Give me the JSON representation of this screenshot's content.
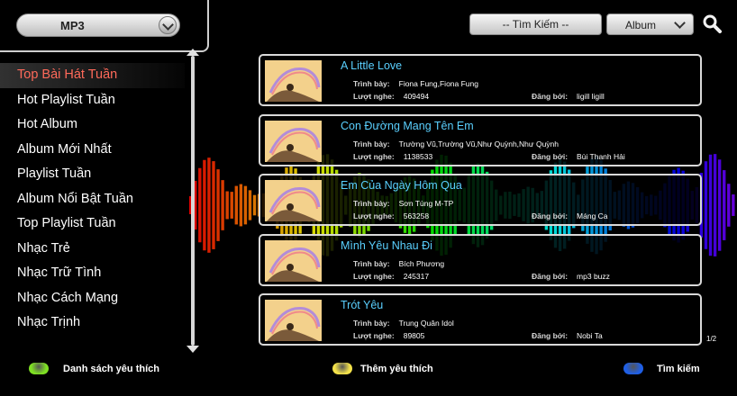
{
  "source": {
    "selected": "MP3"
  },
  "search": {
    "placeholder": "-- Tìm Kiếm --",
    "type_selected": "Album"
  },
  "categories": [
    {
      "label": "Top Bài Hát Tuần",
      "active": true
    },
    {
      "label": "Hot Playlist Tuần"
    },
    {
      "label": "Hot Album"
    },
    {
      "label": "Album Mới Nhất"
    },
    {
      "label": "Playlist Tuần"
    },
    {
      "label": "Album Nổi Bật Tuần"
    },
    {
      "label": "Top Playlist Tuần"
    },
    {
      "label": "Nhạc Trẻ"
    },
    {
      "label": "Nhạc Trữ Tình"
    },
    {
      "label": "Nhạc Cách Mạng"
    },
    {
      "label": "Nhạc Trịnh"
    }
  ],
  "labels": {
    "artist": "Trình bày:",
    "plays": "Lượt nghe:",
    "posted_by": "Đăng bởi:"
  },
  "songs": [
    {
      "title": "A Little Love",
      "artist": "Fiona Fung,Fiona Fung",
      "plays": "409494",
      "posted_by": "ligill ligill"
    },
    {
      "title": "Con Đường Mang Tên Em",
      "artist": "Trường Vũ,Trường Vũ,Như Quỳnh,Như Quỳnh",
      "plays": "1138533",
      "posted_by": "Bùi Thanh Hải"
    },
    {
      "title": "Em Của Ngày Hôm Qua",
      "artist": "Sơn Tùng M-TP",
      "plays": "563258",
      "posted_by": "Máng Ca"
    },
    {
      "title": "Mình Yêu Nhau Đi",
      "artist": "Bích Phương",
      "plays": "245317",
      "posted_by": "mp3 buzz"
    },
    {
      "title": "Trót Yêu",
      "artist": "Trung Quân Idol",
      "plays": "89805",
      "posted_by": "Nobi Ta"
    }
  ],
  "page_indicator": "1/2",
  "legend": [
    {
      "label": "Danh sách yêu thích",
      "color": "#7ee023"
    },
    {
      "label": "Thêm yêu thích",
      "color": "#f4e24a"
    },
    {
      "label": "Tìm kiếm",
      "color": "#1f5fe6"
    }
  ],
  "colors": {
    "active_category": "#ff6a5a",
    "song_title": "#5ad0ff"
  }
}
